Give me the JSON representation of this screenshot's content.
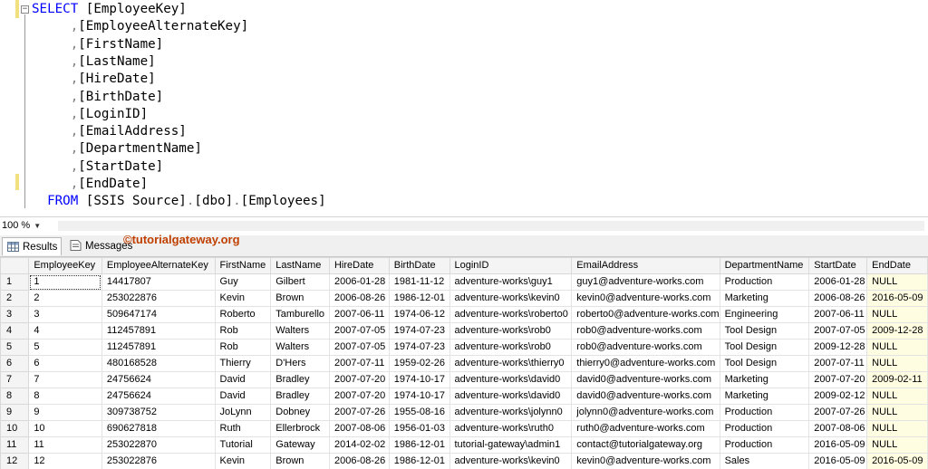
{
  "editor": {
    "lines": [
      {
        "keyword": "SELECT",
        "text": " [EmployeeKey]"
      },
      {
        "indent": "     ",
        "comma": ",",
        "text": "[EmployeeAlternateKey]"
      },
      {
        "indent": "     ",
        "comma": ",",
        "text": "[FirstName]"
      },
      {
        "indent": "     ",
        "comma": ",",
        "text": "[LastName]"
      },
      {
        "indent": "     ",
        "comma": ",",
        "text": "[HireDate]"
      },
      {
        "indent": "     ",
        "comma": ",",
        "text": "[BirthDate]"
      },
      {
        "indent": "     ",
        "comma": ",",
        "text": "[LoginID]"
      },
      {
        "indent": "     ",
        "comma": ",",
        "text": "[EmailAddress]"
      },
      {
        "indent": "     ",
        "comma": ",",
        "text": "[DepartmentName]"
      },
      {
        "indent": "     ",
        "comma": ",",
        "text": "[StartDate]"
      },
      {
        "indent": "     ",
        "comma": ",",
        "text": "[EndDate]"
      },
      {
        "indent": "  ",
        "keyword": "FROM",
        "text": " [SSIS Source]",
        "dot1": ".",
        "text2": "[dbo]",
        "dot2": ".",
        "text3": "[Employees]"
      }
    ],
    "outline_glyph": "−"
  },
  "zoom": {
    "label": "100 %",
    "arrow": "▼"
  },
  "tabs": {
    "results": "Results",
    "messages": "Messages"
  },
  "watermark": "©tutorialgateway.org",
  "grid": {
    "columns": [
      "EmployeeKey",
      "EmployeeAlternateKey",
      "FirstName",
      "LastName",
      "HireDate",
      "BirthDate",
      "LoginID",
      "EmailAddress",
      "DepartmentName",
      "StartDate",
      "EndDate"
    ],
    "rows": [
      [
        "1",
        "1",
        "14417807",
        "Guy",
        "Gilbert",
        "2006-01-28",
        "1981-11-12",
        "adventure-works\\guy1",
        "guy1@adventure-works.com",
        "Production",
        "2006-01-28",
        "NULL"
      ],
      [
        "2",
        "2",
        "253022876",
        "Kevin",
        "Brown",
        "2006-08-26",
        "1986-12-01",
        "adventure-works\\kevin0",
        "kevin0@adventure-works.com",
        "Marketing",
        "2006-08-26",
        "2016-05-09"
      ],
      [
        "3",
        "3",
        "509647174",
        "Roberto",
        "Tamburello",
        "2007-06-11",
        "1974-06-12",
        "adventure-works\\roberto0",
        "roberto0@adventure-works.com",
        "Engineering",
        "2007-06-11",
        "NULL"
      ],
      [
        "4",
        "4",
        "112457891",
        "Rob",
        "Walters",
        "2007-07-05",
        "1974-07-23",
        "adventure-works\\rob0",
        "rob0@adventure-works.com",
        "Tool Design",
        "2007-07-05",
        "2009-12-28"
      ],
      [
        "5",
        "5",
        "112457891",
        "Rob",
        "Walters",
        "2007-07-05",
        "1974-07-23",
        "adventure-works\\rob0",
        "rob0@adventure-works.com",
        "Tool Design",
        "2009-12-28",
        "NULL"
      ],
      [
        "6",
        "6",
        "480168528",
        "Thierry",
        "D'Hers",
        "2007-07-11",
        "1959-02-26",
        "adventure-works\\thierry0",
        "thierry0@adventure-works.com",
        "Tool Design",
        "2007-07-11",
        "NULL"
      ],
      [
        "7",
        "7",
        "24756624",
        "David",
        "Bradley",
        "2007-07-20",
        "1974-10-17",
        "adventure-works\\david0",
        "david0@adventure-works.com",
        "Marketing",
        "2007-07-20",
        "2009-02-11"
      ],
      [
        "8",
        "8",
        "24756624",
        "David",
        "Bradley",
        "2007-07-20",
        "1974-10-17",
        "adventure-works\\david0",
        "david0@adventure-works.com",
        "Marketing",
        "2009-02-12",
        "NULL"
      ],
      [
        "9",
        "9",
        "309738752",
        "JoLynn",
        "Dobney",
        "2007-07-26",
        "1955-08-16",
        "adventure-works\\jolynn0",
        "jolynn0@adventure-works.com",
        "Production",
        "2007-07-26",
        "NULL"
      ],
      [
        "10",
        "10",
        "690627818",
        "Ruth",
        "Ellerbrock",
        "2007-08-06",
        "1956-01-03",
        "adventure-works\\ruth0",
        "ruth0@adventure-works.com",
        "Production",
        "2007-08-06",
        "NULL"
      ],
      [
        "11",
        "11",
        "253022870",
        "Tutorial",
        "Gateway",
        "2014-02-02",
        "1986-12-01",
        "tutorial-gateway\\admin1",
        "contact@tutorialgateway.org",
        "Production",
        "2016-05-09",
        "NULL"
      ],
      [
        "12",
        "12",
        "253022876",
        "Kevin",
        "Brown",
        "2006-08-26",
        "1986-12-01",
        "adventure-works\\kevin0",
        "kevin0@adventure-works.com",
        "Sales",
        "2016-05-09",
        "2016-05-09"
      ]
    ]
  }
}
